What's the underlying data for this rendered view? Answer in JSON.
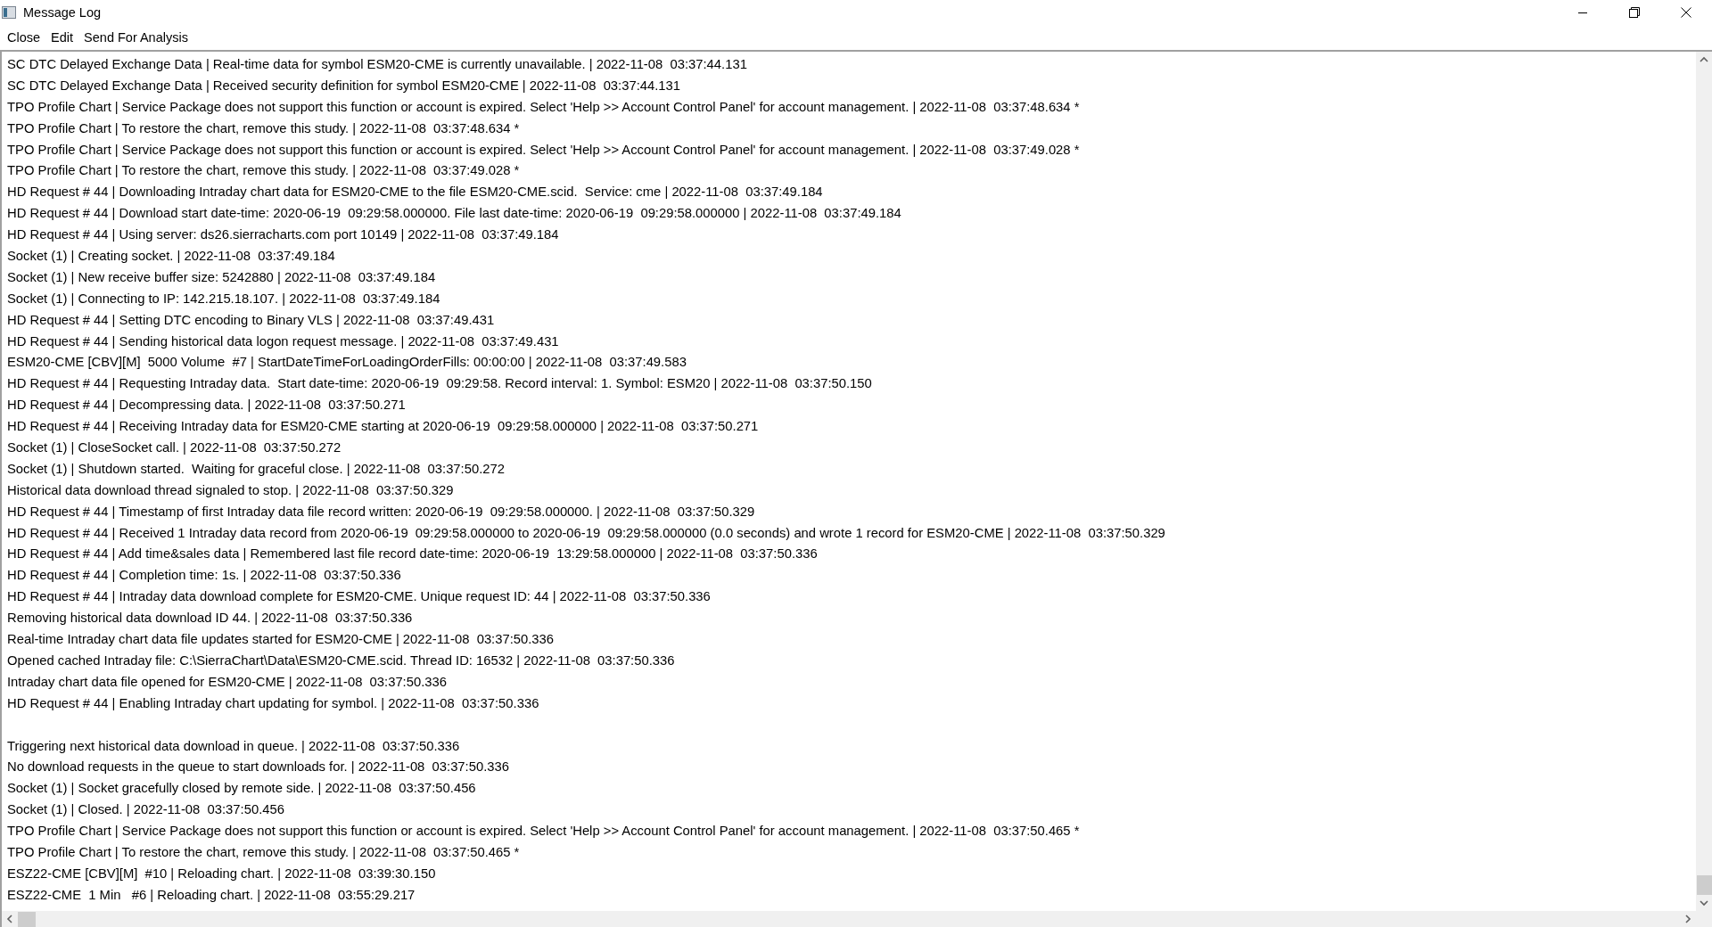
{
  "window": {
    "title": "Message Log"
  },
  "menu": [
    "Close",
    "Edit",
    "Send For Analysis"
  ],
  "log": [
    {
      "kind": "message",
      "text": "SC DTC Delayed Exchange Data | Real-time data for symbol ESM20-CME is currently unavailable. | 2022-11-08  03:37:44.131"
    },
    {
      "kind": "message",
      "text": "SC DTC Delayed Exchange Data | Received security definition for symbol ESM20-CME | 2022-11-08  03:37:44.131"
    },
    {
      "kind": "message",
      "text": "TPO Profile Chart | Service Package does not support this function or account is expired. Select 'Help >> Account Control Panel' for account management. | 2022-11-08  03:37:48.634 *"
    },
    {
      "kind": "message",
      "text": "TPO Profile Chart | To restore the chart, remove this study. | 2022-11-08  03:37:48.634 *"
    },
    {
      "kind": "message",
      "text": "TPO Profile Chart | Service Package does not support this function or account is expired. Select 'Help >> Account Control Panel' for account management. | 2022-11-08  03:37:49.028 *"
    },
    {
      "kind": "message",
      "text": "TPO Profile Chart | To restore the chart, remove this study. | 2022-11-08  03:37:49.028 *"
    },
    {
      "kind": "message",
      "text": "HD Request # 44 | Downloading Intraday chart data for ESM20-CME to the file ESM20-CME.scid.  Service: cme | 2022-11-08  03:37:49.184"
    },
    {
      "kind": "message",
      "text": "HD Request # 44 | Download start date-time: 2020-06-19  09:29:58.000000. File last date-time: 2020-06-19  09:29:58.000000 | 2022-11-08  03:37:49.184"
    },
    {
      "kind": "message",
      "text": "HD Request # 44 | Using server: ds26.sierracharts.com port 10149 | 2022-11-08  03:37:49.184"
    },
    {
      "kind": "message",
      "text": "Socket (1) | Creating socket. | 2022-11-08  03:37:49.184"
    },
    {
      "kind": "message",
      "text": "Socket (1) | New receive buffer size: 5242880 | 2022-11-08  03:37:49.184"
    },
    {
      "kind": "message",
      "text": "Socket (1) | Connecting to IP: 142.215.18.107. | 2022-11-08  03:37:49.184"
    },
    {
      "kind": "message",
      "text": "HD Request # 44 | Setting DTC encoding to Binary VLS | 2022-11-08  03:37:49.431"
    },
    {
      "kind": "message",
      "text": "HD Request # 44 | Sending historical data logon request message. | 2022-11-08  03:37:49.431"
    },
    {
      "kind": "message",
      "text": "ESM20-CME [CBV][M]  5000 Volume  #7 | StartDateTimeForLoadingOrderFills: 00:00:00 | 2022-11-08  03:37:49.583"
    },
    {
      "kind": "message",
      "text": "HD Request # 44 | Requesting Intraday data.  Start date-time: 2020-06-19  09:29:58. Record interval: 1. Symbol: ESM20 | 2022-11-08  03:37:50.150"
    },
    {
      "kind": "message",
      "text": "HD Request # 44 | Decompressing data. | 2022-11-08  03:37:50.271"
    },
    {
      "kind": "message",
      "text": "HD Request # 44 | Receiving Intraday data for ESM20-CME starting at 2020-06-19  09:29:58.000000 | 2022-11-08  03:37:50.271"
    },
    {
      "kind": "message",
      "text": "Socket (1) | CloseSocket call. | 2022-11-08  03:37:50.272"
    },
    {
      "kind": "message",
      "text": "Socket (1) | Shutdown started.  Waiting for graceful close. | 2022-11-08  03:37:50.272"
    },
    {
      "kind": "message",
      "text": "Historical data download thread signaled to stop. | 2022-11-08  03:37:50.329"
    },
    {
      "kind": "message",
      "text": "HD Request # 44 | Timestamp of first Intraday data file record written: 2020-06-19  09:29:58.000000. | 2022-11-08  03:37:50.329"
    },
    {
      "kind": "message",
      "text": "HD Request # 44 | Received 1 Intraday data record from 2020-06-19  09:29:58.000000 to 2020-06-19  09:29:58.000000 (0.0 seconds) and wrote 1 record for ESM20-CME | 2022-11-08  03:37:50.329"
    },
    {
      "kind": "message",
      "text": "HD Request # 44 | Add time&sales data | Remembered last file record date-time: 2020-06-19  13:29:58.000000 | 2022-11-08  03:37:50.336"
    },
    {
      "kind": "message",
      "text": "HD Request # 44 | Completion time: 1s. | 2022-11-08  03:37:50.336"
    },
    {
      "kind": "message",
      "text": "HD Request # 44 | Intraday data download complete for ESM20-CME. Unique request ID: 44 | 2022-11-08  03:37:50.336"
    },
    {
      "kind": "message",
      "text": "Removing historical data download ID 44. | 2022-11-08  03:37:50.336"
    },
    {
      "kind": "message",
      "text": "Real-time Intraday chart data file updates started for ESM20-CME | 2022-11-08  03:37:50.336"
    },
    {
      "kind": "message",
      "text": "Opened cached Intraday file: C:\\SierraChart\\Data\\ESM20-CME.scid. Thread ID: 16532 | 2022-11-08  03:37:50.336"
    },
    {
      "kind": "message",
      "text": "Intraday chart data file opened for ESM20-CME | 2022-11-08  03:37:50.336"
    },
    {
      "kind": "message",
      "text": "HD Request # 44 | Enabling Intraday chart updating for symbol. | 2022-11-08  03:37:50.336"
    },
    {
      "kind": "gap"
    },
    {
      "kind": "message",
      "text": "Triggering next historical data download in queue. | 2022-11-08  03:37:50.336"
    },
    {
      "kind": "message",
      "text": "No download requests in the queue to start downloads for. | 2022-11-08  03:37:50.336"
    },
    {
      "kind": "message",
      "text": "Socket (1) | Socket gracefully closed by remote side. | 2022-11-08  03:37:50.456"
    },
    {
      "kind": "message",
      "text": "Socket (1) | Closed. | 2022-11-08  03:37:50.456"
    },
    {
      "kind": "message",
      "text": "TPO Profile Chart | Service Package does not support this function or account is expired. Select 'Help >> Account Control Panel' for account management. | 2022-11-08  03:37:50.465 *"
    },
    {
      "kind": "message",
      "text": "TPO Profile Chart | To restore the chart, remove this study. | 2022-11-08  03:37:50.465 *"
    },
    {
      "kind": "message",
      "text": "ESZ22-CME [CBV][M]  #10 | Reloading chart. | 2022-11-08  03:39:30.150"
    },
    {
      "kind": "message",
      "text": "ESZ22-CME  1 Min   #6 | Reloading chart. | 2022-11-08  03:55:29.217"
    }
  ]
}
